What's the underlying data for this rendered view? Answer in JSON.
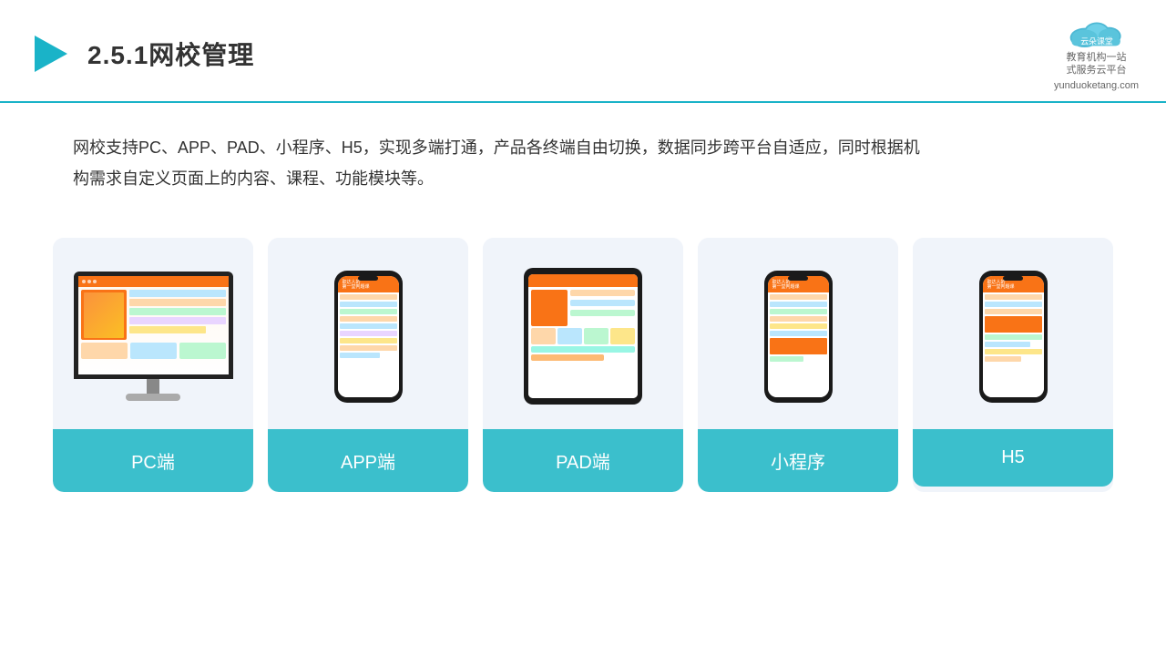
{
  "header": {
    "title": "2.5.1网校管理",
    "logo_name": "云朵课堂",
    "logo_sub": "教育机构一站\n式服务云平台",
    "logo_url": "yunduoketang.com"
  },
  "description": {
    "text": "网校支持PC、APP、PAD、小程序、H5，实现多端打通，产品各终端自由切换，数据同步跨平台自适应，同时根据机构需求自定义页面上的内容、课程、功能模块等。"
  },
  "cards": [
    {
      "id": "pc",
      "label": "PC端"
    },
    {
      "id": "app",
      "label": "APP端"
    },
    {
      "id": "pad",
      "label": "PAD端"
    },
    {
      "id": "miniprogram",
      "label": "小程序"
    },
    {
      "id": "h5",
      "label": "H5"
    }
  ],
  "colors": {
    "accent": "#3bbfcc",
    "title": "#333333",
    "card_bg": "#f0f4fa",
    "header_border": "#1ab3c8"
  }
}
